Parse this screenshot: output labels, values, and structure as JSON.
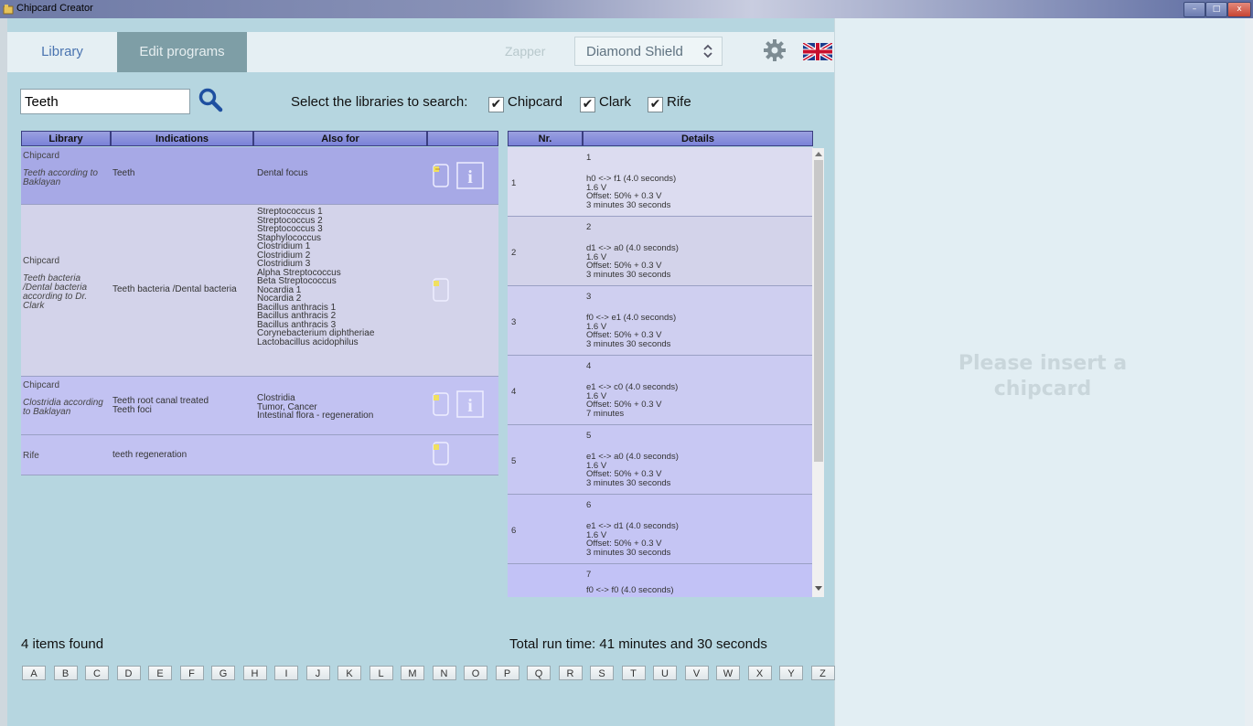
{
  "window": {
    "title": "Chipcard Creator",
    "minimize": "–",
    "maximize": "□",
    "close": "x"
  },
  "nav": {
    "tab_library": "Library",
    "tab_edit": "Edit programs",
    "zapper_label": "Zapper",
    "zapper_value": "Diamond Shield",
    "zapper_arrows": "◇"
  },
  "search": {
    "value": "Teeth",
    "libs_label": "Select the libraries to search:",
    "checkboxes": [
      {
        "label": "Chipcard",
        "checked": true
      },
      {
        "label": "Clark",
        "checked": true
      },
      {
        "label": "Rife",
        "checked": true
      }
    ]
  },
  "lib_table": {
    "headers": [
      "Library",
      "Indications",
      "Also for",
      ""
    ],
    "rows": [
      {
        "library": "Chipcard",
        "sub": "Teeth according to Baklayan",
        "indication": "Teeth",
        "also": "Dental focus"
      },
      {
        "library": "Chipcard",
        "sub": "Teeth bacteria /Dental bacteria according to Dr. Clark",
        "indication": "Teeth bacteria /Dental bacteria",
        "also": "Streptococcus 1\nStreptococcus 2\nStreptococcus 3\nStaphylococcus\nClostridium 1\nClostridium 2\nClostridium 3\nAlpha Streptococcus\nBeta Streptococcus\nNocardia 1\nNocardia 2\nBacillus anthracis 1\nBacillus anthracis 2\nBacillus anthracis 3\nCorynebacterium diphtheriae\nLactobacillus acidophilus"
      },
      {
        "library": "Chipcard",
        "sub": "Clostridia according to Baklayan",
        "indication": "Teeth root canal treated\nTeeth foci",
        "also": "Clostridia\nTumor, Cancer\nIntestinal flora - regeneration"
      },
      {
        "library": "Rife",
        "sub": "",
        "indication": "teeth regeneration",
        "also": ""
      }
    ]
  },
  "prog_table": {
    "headers": [
      "Nr.",
      "Details"
    ],
    "rows": [
      {
        "nr": "1",
        "head": "1",
        "detail": "h0 <-> f1 (4.0 seconds)\n1.6 V\nOffset: 50% + 0.3 V\n3 minutes 30 seconds"
      },
      {
        "nr": "2",
        "head": "2",
        "detail": "d1 <-> a0 (4.0 seconds)\n1.6 V\nOffset: 50% + 0.3 V\n3 minutes 30 seconds"
      },
      {
        "nr": "3",
        "head": "3",
        "detail": "f0 <-> e1 (4.0 seconds)\n1.6 V\nOffset: 50% + 0.3 V\n3 minutes 30 seconds"
      },
      {
        "nr": "4",
        "head": "4",
        "detail": "e1 <-> c0 (4.0 seconds)\n1.6 V\nOffset: 50% + 0.3 V\n7 minutes"
      },
      {
        "nr": "5",
        "head": "5",
        "detail": "e1 <-> a0 (4.0 seconds)\n1.6 V\nOffset: 50% + 0.3 V\n3 minutes 30 seconds"
      },
      {
        "nr": "6",
        "head": "6",
        "detail": "e1 <-> d1 (4.0 seconds)\n1.6 V\nOffset: 50% + 0.3 V\n3 minutes 30 seconds"
      },
      {
        "nr": "",
        "head": "7",
        "detail": "f0 <-> f0 (4.0 seconds)"
      }
    ]
  },
  "footer": {
    "items_found": "4 items found",
    "total_run": "Total run time: 41 minutes and 30 seconds",
    "letters": [
      "A",
      "B",
      "C",
      "D",
      "E",
      "F",
      "G",
      "H",
      "I",
      "J",
      "K",
      "L",
      "M",
      "N",
      "O",
      "P",
      "Q",
      "R",
      "S",
      "T",
      "U",
      "V",
      "W",
      "X",
      "Y",
      "Z"
    ]
  },
  "right_panel": {
    "message_line1": "Please insert a",
    "message_line2": "chipcard"
  },
  "colors": {
    "row_selected": "#a7a9e6",
    "row_alt": "#c2c2f2",
    "row_plain": "#d3d3ea",
    "header": "#8a90dc"
  }
}
